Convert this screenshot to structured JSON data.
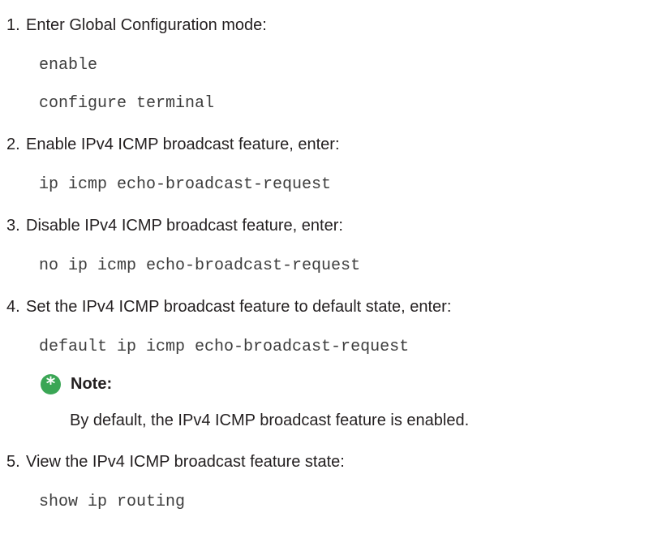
{
  "steps": [
    {
      "num": "1.",
      "text": "Enter Global Configuration mode:",
      "commands": [
        "enable",
        "configure terminal"
      ]
    },
    {
      "num": "2.",
      "text": "Enable IPv4 ICMP broadcast feature, enter:",
      "commands": [
        "ip icmp echo-broadcast-request"
      ]
    },
    {
      "num": "3.",
      "text": "Disable IPv4 ICMP broadcast feature, enter:",
      "commands": [
        "no ip icmp echo-broadcast-request"
      ]
    },
    {
      "num": "4.",
      "text": "Set the IPv4 ICMP broadcast feature to default state, enter:",
      "commands": [
        "default ip icmp echo-broadcast-request"
      ]
    },
    {
      "num": "5.",
      "text": "View the IPv4 ICMP broadcast feature state:",
      "commands": [
        "show ip routing"
      ]
    }
  ],
  "note": {
    "icon": "asterisk-icon",
    "label": "Note:",
    "body": "By default, the IPv4 ICMP broadcast feature is enabled.",
    "icon_color": "#3aa655"
  }
}
